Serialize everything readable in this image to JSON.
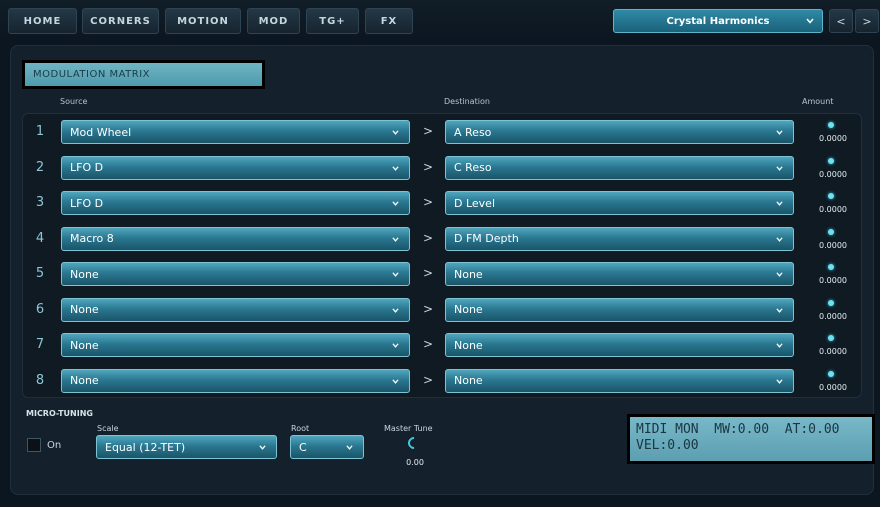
{
  "nav": {
    "tabs": [
      {
        "label": "HOME"
      },
      {
        "label": "CORNERS"
      },
      {
        "label": "MOTION"
      },
      {
        "label": "MOD"
      },
      {
        "label": "TG+"
      },
      {
        "label": "FX"
      }
    ],
    "preset": "Crystal Harmonics",
    "prev": "<",
    "next": ">"
  },
  "matrix": {
    "title": "MODULATION MATRIX",
    "headers": {
      "source": "Source",
      "destination": "Destination",
      "amount": "Amount"
    },
    "arrow": ">",
    "rows": [
      {
        "num": "1",
        "source": "Mod Wheel",
        "destination": "A Reso",
        "amount": "0.0000"
      },
      {
        "num": "2",
        "source": "LFO D",
        "destination": "C Reso",
        "amount": "0.0000"
      },
      {
        "num": "3",
        "source": "LFO D",
        "destination": "D Level",
        "amount": "0.0000"
      },
      {
        "num": "4",
        "source": "Macro 8",
        "destination": "D FM Depth",
        "amount": "0.0000"
      },
      {
        "num": "5",
        "source": "None",
        "destination": "None",
        "amount": "0.0000"
      },
      {
        "num": "6",
        "source": "None",
        "destination": "None",
        "amount": "0.0000"
      },
      {
        "num": "7",
        "source": "None",
        "destination": "None",
        "amount": "0.0000"
      },
      {
        "num": "8",
        "source": "None",
        "destination": "None",
        "amount": "0.0000"
      }
    ]
  },
  "tuning": {
    "title": "MICRO-TUNING",
    "on_label": "On",
    "on": false,
    "scale_label": "Scale",
    "scale": "Equal (12-TET)",
    "root_label": "Root",
    "root": "C",
    "master_label": "Master Tune",
    "master_value": "0.00"
  },
  "midimon": {
    "line1": "MIDI MON  MW:0.00  AT:0.00",
    "line2": "VEL:0.00"
  },
  "icons": {
    "dropdown": "chevron-down-icon"
  },
  "colors": {
    "accent": "#2a7891",
    "display": "#6fb4c4",
    "knob": "#6fe0f0"
  }
}
